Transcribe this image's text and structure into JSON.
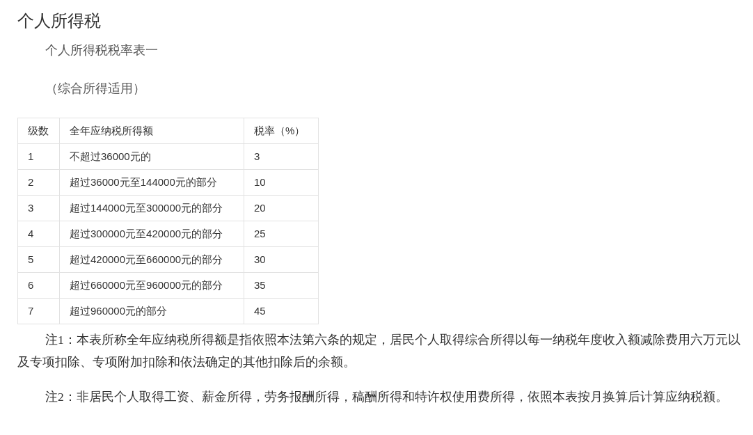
{
  "title": "个人所得税",
  "subtitle": "个人所得税税率表一",
  "scope": "（综合所得适用）",
  "table": {
    "columns": [
      "级数",
      "全年应纳税所得额",
      "税率（%）"
    ],
    "rows": [
      [
        "1",
        "不超过36000元的",
        "3"
      ],
      [
        "2",
        "超过36000元至144000元的部分",
        "10"
      ],
      [
        "3",
        "超过144000元至300000元的部分",
        "20"
      ],
      [
        "4",
        "超过300000元至420000元的部分",
        "25"
      ],
      [
        "5",
        "超过420000元至660000元的部分",
        "30"
      ],
      [
        "6",
        "超过660000元至960000元的部分",
        "35"
      ],
      [
        "7",
        "超过960000元的部分",
        "45"
      ]
    ]
  },
  "notes": [
    "注1：本表所称全年应纳税所得额是指依照本法第六条的规定，居民个人取得综合所得以每一纳税年度收入额减除费用六万元以及专项扣除、专项附加扣除和依法确定的其他扣除后的余额。",
    "注2：非居民个人取得工资、薪金所得，劳务报酬所得，稿酬所得和特许权使用费所得，依照本表按月换算后计算应纳税额。"
  ]
}
